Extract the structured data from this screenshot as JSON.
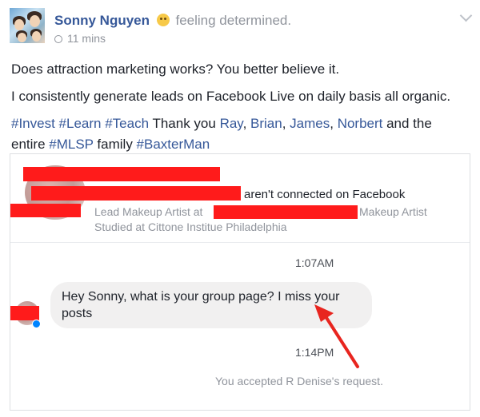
{
  "post": {
    "author": "Sonny Nguyen",
    "feeling": "feeling determined.",
    "feeling_icon": "determined-emoji-icon",
    "time": "11 mins",
    "paragraph_1": "Does attraction marketing works? You better believe it.",
    "paragraph_2": "I consistently generate leads on Facebook Live on daily basis all organic.",
    "tags": {
      "invest": "#Invest",
      "learn": "#Learn",
      "teach": "#Teach",
      "thank_you": " Thank you ",
      "ray": "Ray",
      "comma_1": ", ",
      "brian": "Brian",
      "comma_2": ", ",
      "james": "James",
      "comma_3": ", ",
      "norbert": "Norbert",
      "and_entire": " and the entire ",
      "mlsp": "#MLSP",
      "family": " family ",
      "baxterman": "#BaxterMan"
    }
  },
  "card": {
    "not_connected": "aren't connected on Facebook",
    "job_title": "Lead Makeup Artist at",
    "employer_suffix": "Makeup Artist",
    "education": "Studied at Cittone Institue Philadelphia",
    "time_1": "1:07AM",
    "message": "Hey Sonny, what is your group page? I miss your posts",
    "time_2": "1:14PM",
    "accepted": "You accepted R Denise's request."
  },
  "colors": {
    "link": "#365899",
    "redaction": "#ff1b1b",
    "arrow": "#e8251f",
    "bubble": "#f1f0f0"
  }
}
